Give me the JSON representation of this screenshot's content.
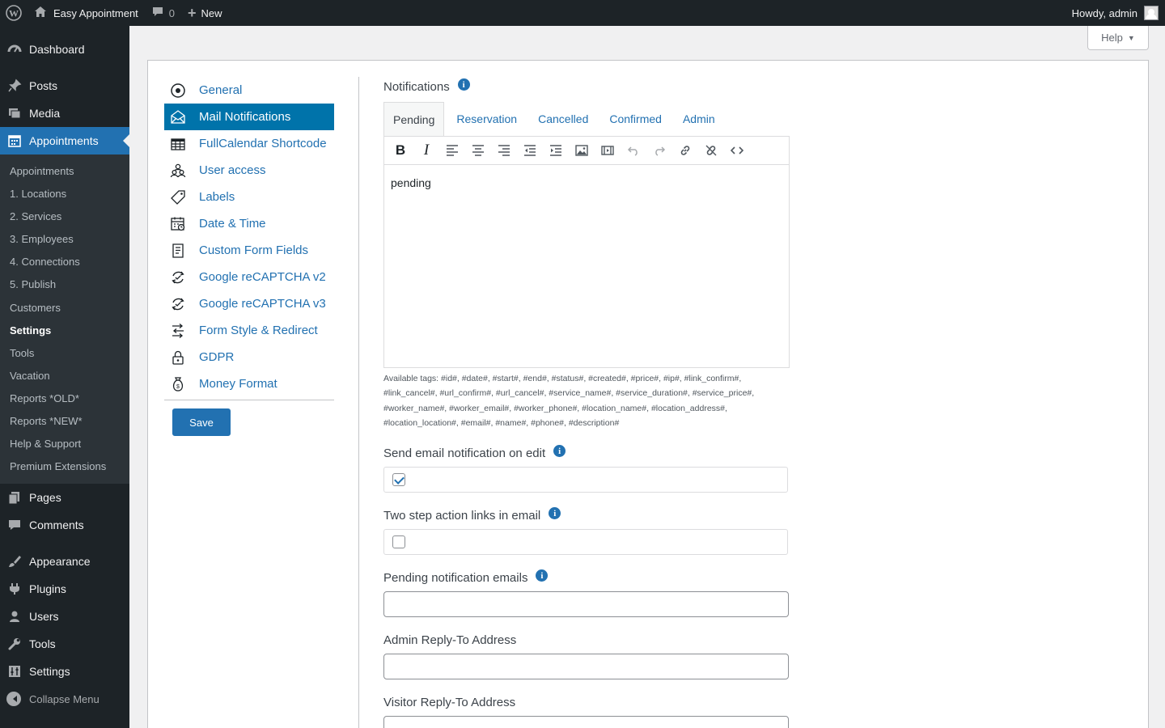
{
  "admin_bar": {
    "site_name": "Easy Appointment",
    "comments_count": "0",
    "new_label": "New",
    "howdy": "Howdy, admin"
  },
  "sidebar": {
    "top_items": [
      {
        "label": "Dashboard",
        "icon": "dashboard-icon"
      },
      {
        "label": "Posts",
        "icon": "pin-icon"
      },
      {
        "label": "Media",
        "icon": "media-icon"
      },
      {
        "label": "Appointments",
        "icon": "calendar-icon",
        "current": true
      }
    ],
    "sub_items": [
      "Appointments",
      "1. Locations",
      "2. Services",
      "3. Employees",
      "4. Connections",
      "5. Publish",
      "Customers",
      "Settings",
      "Tools",
      "Vacation",
      "Reports *OLD*",
      "Reports *NEW*",
      "Help & Support",
      "Premium Extensions"
    ],
    "sub_current": "Settings",
    "bottom_items": [
      {
        "label": "Pages",
        "icon": "pages-icon"
      },
      {
        "label": "Comments",
        "icon": "comments-icon"
      },
      {
        "label": "Appearance",
        "icon": "brush-icon"
      },
      {
        "label": "Plugins",
        "icon": "plugin-icon"
      },
      {
        "label": "Users",
        "icon": "users-icon"
      },
      {
        "label": "Tools",
        "icon": "wrench-icon"
      },
      {
        "label": "Settings",
        "icon": "settings-icon"
      }
    ],
    "collapse_label": "Collapse Menu"
  },
  "help_button": "Help",
  "settings_nav": {
    "items": [
      {
        "label": "General",
        "icon": "target-icon"
      },
      {
        "label": "Mail Notifications",
        "icon": "envelope-icon",
        "active": true
      },
      {
        "label": "FullCalendar Shortcode",
        "icon": "table-icon"
      },
      {
        "label": "User access",
        "icon": "user-group-icon"
      },
      {
        "label": "Labels",
        "icon": "tag-icon"
      },
      {
        "label": "Date & Time",
        "icon": "calendar-clock-icon"
      },
      {
        "label": "Custom Form Fields",
        "icon": "form-icon"
      },
      {
        "label": "Google reCAPTCHA v2",
        "icon": "recaptcha-icon"
      },
      {
        "label": "Google reCAPTCHA v3",
        "icon": "recaptcha-icon"
      },
      {
        "label": "Form Style & Redirect",
        "icon": "redirect-icon"
      },
      {
        "label": "GDPR",
        "icon": "lock-icon"
      },
      {
        "label": "Money Format",
        "icon": "money-bag-icon"
      }
    ],
    "save_label": "Save"
  },
  "notifications": {
    "title": "Notifications",
    "tabs": [
      "Pending",
      "Reservation",
      "Cancelled",
      "Confirmed",
      "Admin"
    ],
    "active_tab": "Pending",
    "editor_content": "pending",
    "toolbar_buttons": [
      "bold",
      "italic",
      "align-left",
      "align-center",
      "align-right",
      "outdent",
      "indent",
      "image",
      "media",
      "undo",
      "redo",
      "link",
      "unlink",
      "code"
    ],
    "available_tags": "Available tags: #id#, #date#, #start#, #end#, #status#, #created#, #price#, #ip#, #link_confirm#, #link_cancel#, #url_confirm#, #url_cancel#, #service_name#, #service_duration#, #service_price#, #worker_name#, #worker_email#, #worker_phone#, #location_name#, #location_address#, #location_location#, #email#, #name#, #phone#, #description#"
  },
  "fields": {
    "send_on_edit": {
      "label": "Send email notification on edit",
      "checked": true
    },
    "two_step": {
      "label": "Two step action links in email",
      "checked": false
    },
    "pending_emails": {
      "label": "Pending notification emails",
      "value": ""
    },
    "admin_reply_to": {
      "label": "Admin Reply-To Address",
      "value": ""
    },
    "visitor_reply_to": {
      "label": "Visitor Reply-To Address",
      "value": ""
    }
  },
  "colors": {
    "admin_bar_bg": "#1d2327",
    "accent": "#2271b1",
    "active_nav": "#0073aa"
  }
}
